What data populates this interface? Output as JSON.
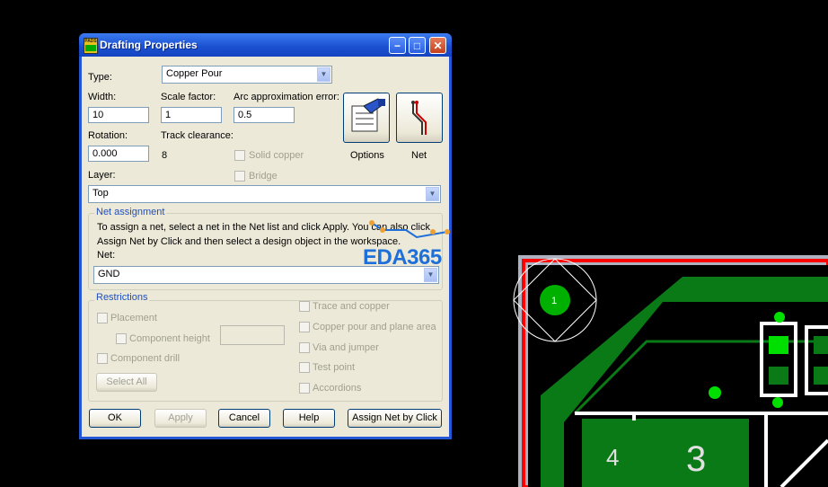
{
  "dialog": {
    "title": "Drafting Properties",
    "app_icon_text": "PADS",
    "type_label": "Type:",
    "type_value": "Copper Pour",
    "width_label": "Width:",
    "width_value": "10",
    "scale_label": "Scale factor:",
    "scale_value": "1",
    "arc_label": "Arc approximation error:",
    "arc_value": "0.5",
    "rotation_label": "Rotation:",
    "rotation_value": "0.000",
    "track_label": "Track clearance:",
    "track_value": "8",
    "solid_copper_label": "Solid copper",
    "bridge_label": "Bridge",
    "options_label": "Options",
    "net_button_label": "Net",
    "layer_label": "Layer:",
    "layer_value": "Top",
    "net_assignment": {
      "title": "Net assignment",
      "instructions_line1": "To assign a net, select a net in the Net list and click Apply. You can also click",
      "instructions_line2": "Assign Net by Click and then select a design object in the workspace.",
      "net_label": "Net:",
      "net_value": "GND"
    },
    "restrictions": {
      "title": "Restrictions",
      "placement": "Placement",
      "component_height": "Component height",
      "component_drill": "Component drill",
      "select_all": "Select All",
      "trace_copper": "Trace and copper",
      "copper_pour_plane": "Copper pour and plane area",
      "via_jumper": "Via and jumper",
      "test_point": "Test point",
      "accordions": "Accordions"
    },
    "buttons": {
      "ok": "OK",
      "apply": "Apply",
      "cancel": "Cancel",
      "help": "Help",
      "assign_net_by_click": "Assign Net by Click"
    }
  },
  "watermark": "EDA365",
  "pcb": {
    "pad_label": "1",
    "component_labels": [
      "4",
      "3"
    ],
    "colors": {
      "board_outline": "#ff0000",
      "copper": "#0a7a17",
      "pad": "#00e000",
      "silkscreen": "#ffffff"
    }
  }
}
